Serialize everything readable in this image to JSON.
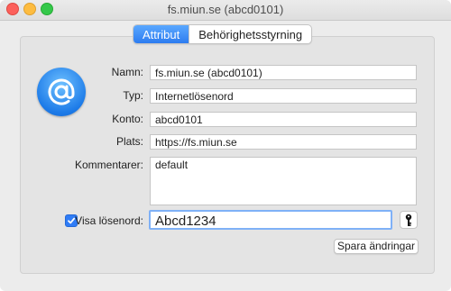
{
  "window": {
    "title": "fs.miun.se (abcd0101)"
  },
  "tabs": [
    {
      "label": "Attribut",
      "active": true
    },
    {
      "label": "Behörighetsstyrning",
      "active": false
    }
  ],
  "icon": {
    "name": "at-sign-icon",
    "color": "#1d7be8"
  },
  "fields": {
    "name": {
      "label": "Namn:",
      "value": "fs.miun.se (abcd0101)"
    },
    "type": {
      "label": "Typ:",
      "value": "Internetlösenord"
    },
    "account": {
      "label": "Konto:",
      "value": "abcd0101"
    },
    "where": {
      "label": "Plats:",
      "value": "https://fs.miun.se"
    },
    "comment": {
      "label": "Kommentarer:",
      "value": "default"
    }
  },
  "password": {
    "show_label": "Visa lösenord:",
    "checked": true,
    "value": "Abcd1234",
    "key_icon": "key-icon"
  },
  "buttons": {
    "save": "Spara ändringar"
  },
  "colors": {
    "accent": "#2d7cf0"
  }
}
